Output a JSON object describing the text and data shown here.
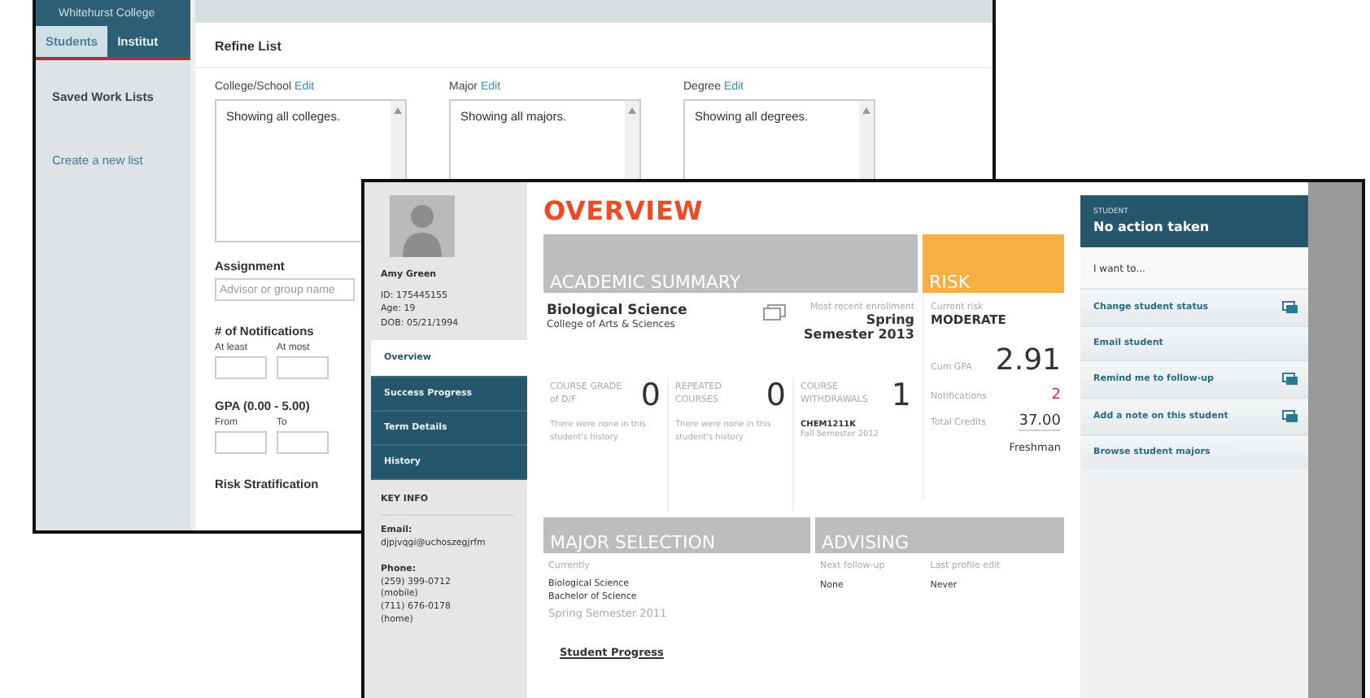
{
  "back_window": {
    "college_name": "Whitehurst College",
    "tabs": [
      {
        "label": "Students",
        "selected": true
      },
      {
        "label": "Institut",
        "selected": false
      }
    ],
    "sidebar": {
      "items": [
        {
          "label": "Saved Work Lists",
          "kind": "heading"
        },
        {
          "label": "Create a new list",
          "kind": "link"
        }
      ]
    },
    "refine": {
      "title": "Refine List",
      "filters": [
        {
          "label": "College/School",
          "edit": "Edit",
          "value": "Showing all colleges."
        },
        {
          "label": "Major",
          "edit": "Edit",
          "value": "Showing all majors."
        },
        {
          "label": "Degree",
          "edit": "Edit",
          "value": "Showing all degrees."
        }
      ],
      "assignment": {
        "label": "Assignment",
        "placeholder": "Advisor or group name"
      },
      "notifications": {
        "label": "# of Notifications",
        "fields": [
          "At least",
          "At most"
        ]
      },
      "gpa": {
        "label": "GPA (0.00 - 5.00)",
        "fields": [
          "From",
          "To"
        ]
      },
      "risk": {
        "label": "Risk Stratification"
      }
    }
  },
  "front_window": {
    "student": {
      "name": "Amy Green",
      "details": [
        "ID: 175445155",
        "Age: 19",
        "DOB: 05/21/1994"
      ]
    },
    "nav": [
      {
        "label": "Overview",
        "selected": true
      },
      {
        "label": "Success Progress",
        "selected": false
      },
      {
        "label": "Term Details",
        "selected": false
      },
      {
        "label": "History",
        "selected": false
      }
    ],
    "key_info": {
      "title": "KEY INFO",
      "email_label": "Email:",
      "email": "djpjvqgi@uchoszegjrfm",
      "phone_label": "Phone:",
      "phones": [
        "(259) 399-0712",
        "(mobile)",
        "(711) 676-0178",
        "(home)"
      ]
    },
    "title": "OVERVIEW",
    "academic": {
      "title": "ACADEMIC SUMMARY",
      "major": "Biological Science",
      "college": "College of Arts & Sciences",
      "enrollment_label": "Most recent enrollment",
      "enrollment": "Spring Semester 2013",
      "stats": [
        {
          "label": "COURSE GRADE of D/F",
          "value": "0",
          "note": "There were none in this student's history"
        },
        {
          "label": "REPEATED COURSES",
          "value": "0",
          "note": "There were none in this student's history"
        },
        {
          "label": "COURSE WITHDRAWALS",
          "value": "1",
          "course": "CHEM1211K",
          "term": "Fall Semester 2012"
        }
      ]
    },
    "risk": {
      "title": "RISK",
      "current_label": "Current risk",
      "current": "MODERATE",
      "gpa_label": "Cum GPA",
      "gpa": "2.91",
      "notifications_label": "Notifications",
      "notifications": "2",
      "credits_label": "Total Credits",
      "credits": "37.00",
      "class": "Freshman"
    },
    "major_selection": {
      "title": "MAJOR SELECTION",
      "label": "Currently",
      "lines": [
        "Biological Science",
        "Bachelor of Science"
      ],
      "term": "Spring Semester 2011"
    },
    "advising": {
      "title": "ADVISING",
      "fields": [
        {
          "label": "Next follow-up",
          "value": "None"
        },
        {
          "label": "Last profile edit",
          "value": "Never"
        }
      ]
    },
    "progress_title": "Student Progress",
    "actions": {
      "caption": "STUDENT",
      "status": "No action taken",
      "prompt": "I want to...",
      "items": [
        {
          "label": "Change student status",
          "popup": true
        },
        {
          "label": "Email student",
          "popup": false
        },
        {
          "label": "Remind me to follow-up",
          "popup": true
        },
        {
          "label": "Add a note on this student",
          "popup": true
        },
        {
          "label": "Browse student majors",
          "popup": false
        }
      ]
    }
  }
}
